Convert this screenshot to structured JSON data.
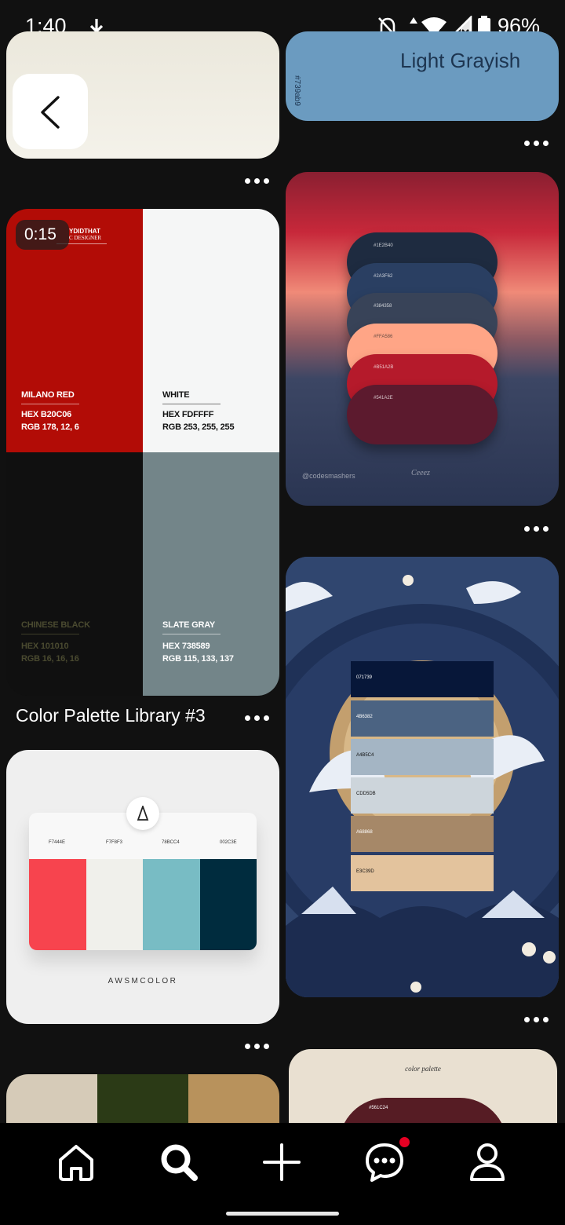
{
  "status_bar": {
    "time": "1:40",
    "battery": "96%",
    "icons": [
      "download-icon",
      "notifications-off-icon",
      "data-arrows-icon",
      "wifi-icon",
      "signal-4g-icon",
      "signal-no-service-icon",
      "battery-icon"
    ]
  },
  "feed": {
    "cards": [
      {
        "id": "top-left",
        "kind": "image",
        "color": "#f1efe6"
      },
      {
        "id": "top-right",
        "text": "Light Grayish",
        "hex": "#739ab9",
        "color": "#6b9bc0"
      },
      {
        "id": "video-palette",
        "duration": "0:15",
        "brand_line1": "YDIDTHAT",
        "brand_line2": "C DESIGNER",
        "colors": [
          {
            "name": "MILANO RED",
            "hex": "HEX  B20C06",
            "rgb": "RGB  178, 12, 6",
            "color": "#b20c06"
          },
          {
            "name": "WHITE",
            "hex": "HEX FDFFFF",
            "rgb": "RGB 253, 255, 255",
            "color": "#f5f6f6"
          },
          {
            "name": "CHINESE BLACK",
            "hex": "HEX 101010",
            "rgb": "RGB 16, 16, 16",
            "color": "#101010"
          },
          {
            "name": "SLATE GRAY",
            "hex": "HEX 738589",
            "rgb": "RGB 115, 133, 137",
            "color": "#738589"
          }
        ],
        "title": "Color Palette Library #3"
      },
      {
        "id": "gradient-pills",
        "credit": "@codesmashers",
        "signature": "Ceeez",
        "pills": [
          {
            "label": "#1E2B40",
            "color": "#1e2b40"
          },
          {
            "label": "#2A3F62",
            "color": "#2a3f62"
          },
          {
            "label": "#384358",
            "color": "#384358"
          },
          {
            "label": "#FFA586",
            "color": "#ffa586"
          },
          {
            "label": "#B51A2B",
            "color": "#b51a2b"
          },
          {
            "label": "#541A2E",
            "color": "#541a2e"
          }
        ]
      },
      {
        "id": "crane-palette",
        "swatches": [
          {
            "label": "071739",
            "color": "#071739"
          },
          {
            "label": "4B6382",
            "color": "#4b6382"
          },
          {
            "label": "A4B5C4",
            "color": "#a4b5c4"
          },
          {
            "label": "CDD5DB",
            "color": "#cdd5db"
          },
          {
            "label": "A68868",
            "color": "#a68868"
          },
          {
            "label": "E3C39D",
            "color": "#e3c39d"
          }
        ]
      },
      {
        "id": "awsm-palette",
        "brand": "AWSMCOLOR",
        "swatches": [
          {
            "label": "F7444E",
            "color": "#f7444e"
          },
          {
            "label": "F7F8F3",
            "color": "#f0f0eb"
          },
          {
            "label": "78BCC4",
            "color": "#78bcc4"
          },
          {
            "label": "002C3E",
            "color": "#002c3e"
          }
        ]
      },
      {
        "id": "bottom-left",
        "colors": [
          "#d6cbb8",
          "#2b3a16",
          "#b8925c"
        ]
      },
      {
        "id": "bottom-right",
        "script_title": "color palette",
        "swatch_label": "#561C24",
        "color": "#561c24"
      }
    ]
  },
  "nav": {
    "back": "back-button",
    "items": [
      {
        "name": "home-tab",
        "icon": "home-icon"
      },
      {
        "name": "search-tab",
        "icon": "search-icon"
      },
      {
        "name": "create-tab",
        "icon": "plus-icon"
      },
      {
        "name": "messages-tab",
        "icon": "chat-icon"
      },
      {
        "name": "profile-tab",
        "icon": "profile-icon"
      }
    ]
  }
}
